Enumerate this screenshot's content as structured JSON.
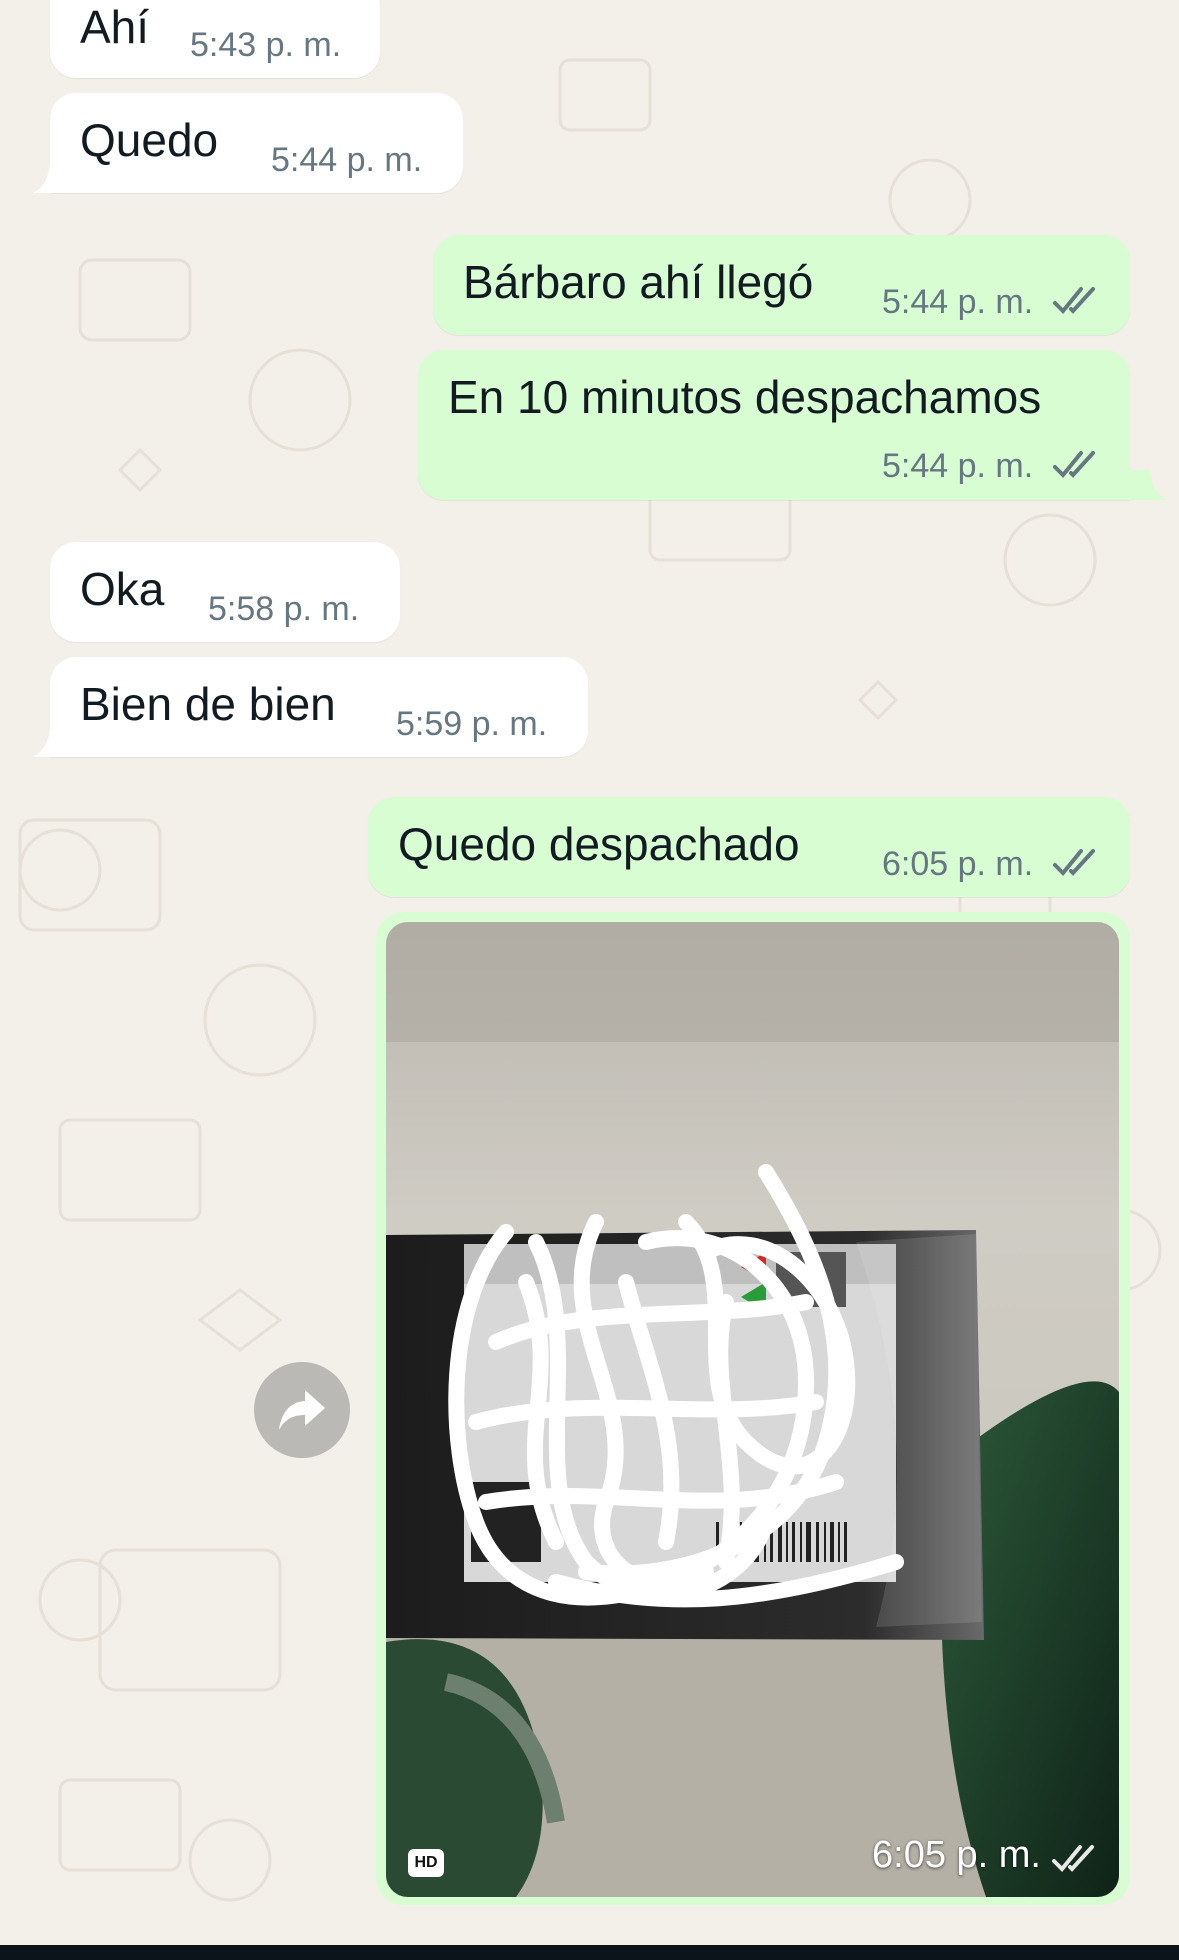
{
  "colors": {
    "chat_background": "#f3efe9",
    "incoming_bubble": "#ffffff",
    "outgoing_bubble": "#d9fdd3",
    "timestamp": "#667781",
    "read_ticks": "#667781"
  },
  "messages": [
    {
      "direction": "incoming",
      "text": "Ahí",
      "time": "5:43 p. m."
    },
    {
      "direction": "incoming",
      "text": "Quedo",
      "time": "5:44 p. m."
    },
    {
      "direction": "outgoing",
      "text": "Bárbaro ahí llegó",
      "time": "5:44 p. m.",
      "status": "read"
    },
    {
      "direction": "outgoing",
      "text": "En 10 minutos despachamos",
      "time": "5:44 p. m.",
      "status": "read"
    },
    {
      "direction": "incoming",
      "text": "Oka",
      "time": "5:58 p. m."
    },
    {
      "direction": "incoming",
      "text": "Bien de bien",
      "time": "5:59 p. m."
    },
    {
      "direction": "outgoing",
      "text": "Quedo despachado",
      "time": "6:05 p. m.",
      "status": "read"
    },
    {
      "direction": "outgoing",
      "type": "image",
      "time": "6:05 p. m.",
      "badge": "HD",
      "status": "read"
    }
  ],
  "icons": {
    "forward": "forward-icon",
    "read_receipt": "double-check-icon"
  }
}
